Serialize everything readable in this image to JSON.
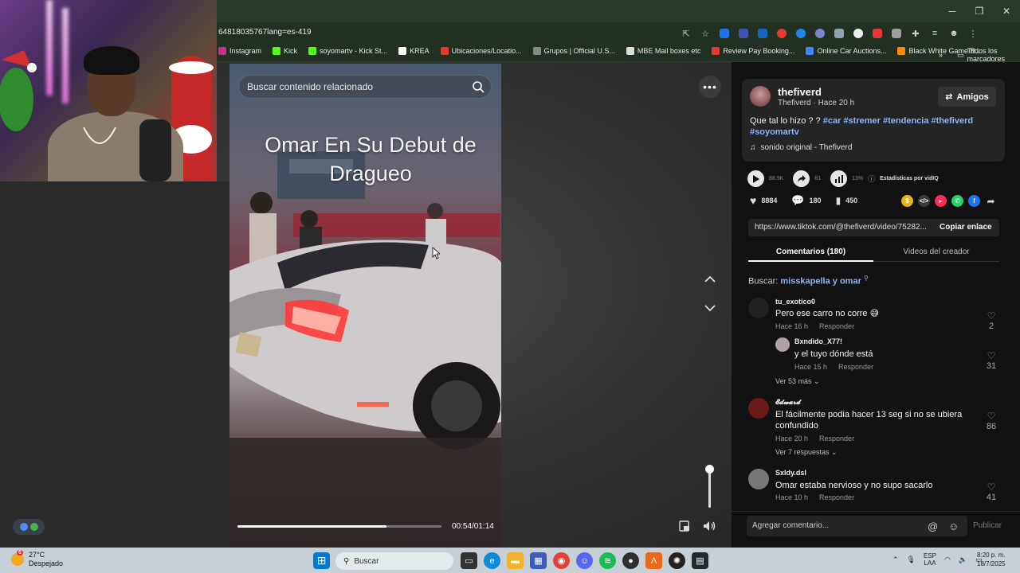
{
  "window": {
    "minimize_glyph": "─",
    "restore_glyph": "❐",
    "close_glyph": "✕"
  },
  "browser": {
    "url": "64818035767lang=es-419",
    "bookmarks": [
      {
        "label": "Instagram",
        "color": "#c13584"
      },
      {
        "label": "Kick",
        "color": "#53fc18"
      },
      {
        "label": "soyomartv - Kick St...",
        "color": "#53fc18"
      },
      {
        "label": "KREA",
        "color": "#ffffff"
      },
      {
        "label": "Ubicaciones/Locatio...",
        "color": "#e53935"
      },
      {
        "label": "Grupos | Official U.S...",
        "color": "#888888"
      },
      {
        "label": "MBE Mail boxes etc",
        "color": "#dddddd"
      },
      {
        "label": "Review Pay Booking...",
        "color": "#e53935"
      },
      {
        "label": "Online Car Auctions...",
        "color": "#4285f4"
      },
      {
        "label": "Black White Game R...",
        "color": "#ff8a00"
      }
    ],
    "bookmarks_more": "»",
    "all_bookmarks": "Todos los marcadores"
  },
  "video": {
    "search_placeholder": "Buscar contenido relacionado",
    "title": "Omar En Su Debut de Dragueo",
    "timecode": "00:54/01:14",
    "progress": 0.73,
    "volume": 1.0,
    "more_label": "•••"
  },
  "creator": {
    "username": "thefiverd",
    "subline": "Thefiverd · Hace 20 h",
    "friends_label": "Amigos",
    "caption_text": "Que tal lo hizo ? ?",
    "hashtags": [
      "#car",
      "#stremer",
      "#tendencia",
      "#thefiverd",
      "#soyomartv"
    ],
    "sound": "sonido original - Thefiverd"
  },
  "stats": {
    "plays": "88.9K",
    "shares_stat": "81",
    "rate": "13%",
    "vidiq": "Estadísticas por vidIQ",
    "likes": "8884",
    "comments": "180",
    "saves": "450"
  },
  "share_icons": [
    {
      "name": "coin-icon",
      "color": "#e7b416",
      "glyph": "$"
    },
    {
      "name": "embed-icon",
      "color": "#3a3a3a",
      "glyph": "</>"
    },
    {
      "name": "send-icon",
      "color": "#fe2c55",
      "glyph": "▸"
    },
    {
      "name": "whatsapp-icon",
      "color": "#25d366",
      "glyph": "✆"
    },
    {
      "name": "facebook-icon",
      "color": "#1877f2",
      "glyph": "f"
    }
  ],
  "link": {
    "url": "https://www.tiktok.com/@thefiverd/video/75282...",
    "copy_label": "Copiar enlace"
  },
  "tabs": {
    "comments": "Comentarios (180)",
    "creator_videos": "Videos del creador"
  },
  "search": {
    "label": "Buscar:",
    "term": "misskapella y omar"
  },
  "comments": [
    {
      "user": "tu_exotico0",
      "text": "Pero ese carro no corre 😅",
      "time": "Hace 16 h",
      "reply": "Responder",
      "likes": "2"
    },
    {
      "user": "Bxndido_X77!",
      "text": "y el tuyo dónde está",
      "time": "Hace 15 h",
      "reply": "Responder",
      "likes": "31",
      "more": "Ver 53 más"
    },
    {
      "user": "𝓔𝓭𝔀𝓪𝓻𝓭",
      "text": "El fácilmente podia hacer 13 seg si no se ubiera confundido",
      "time": "Hace 20 h",
      "reply": "Responder",
      "likes": "86",
      "more": "Ver 7 respuestas"
    },
    {
      "user": "Sxldy.dsl",
      "text": "Omar estaba nervioso y no supo sacarlo",
      "time": "Hace 10 h",
      "reply": "Responder",
      "likes": "41"
    }
  ],
  "composer": {
    "placeholder": "Agregar comentario...",
    "publish": "Publicar"
  },
  "taskbar": {
    "weather_badge": "6",
    "temperature": "27°C",
    "condition": "Despejado",
    "search": "Buscar",
    "lang_top": "ESP",
    "lang_bottom": "LAA",
    "time": "8:20 p. m.",
    "date": "18/7/2025"
  }
}
